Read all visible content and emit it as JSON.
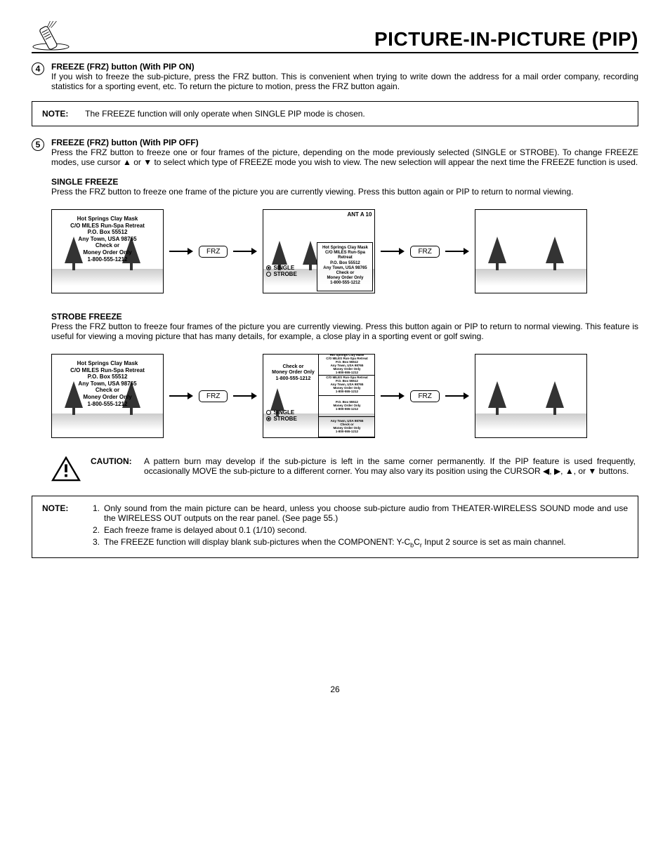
{
  "header": {
    "title": "PICTURE-IN-PICTURE (PIP)"
  },
  "step4": {
    "num": "4",
    "heading": "FREEZE (FRZ) button (With PIP ON)",
    "body": "If you wish to freeze the sub-picture, press the FRZ button.  This is convenient when trying to write down the address for a mail order company, recording statistics for a sporting event, etc.  To return the picture to motion, press the FRZ button again."
  },
  "note1": {
    "label": "NOTE:",
    "text": "The FREEZE function will only operate when SINGLE PIP mode is chosen."
  },
  "step5": {
    "num": "5",
    "heading": "FREEZE (FRZ) button (With PIP OFF)",
    "body": "Press the FRZ button to freeze one or four frames of the picture, depending on the mode previously selected (SINGLE or STROBE).  To change FREEZE modes, use cursor ▲ or ▼ to select which type of FREEZE mode you wish to view. The new selection will appear the next time the FREEZE function is used."
  },
  "single": {
    "heading": "SINGLE FREEZE",
    "body": "Press the FRZ button to freeze one frame of the picture you are currently viewing.  Press this button again or PIP to return to normal viewing."
  },
  "strobe": {
    "heading": "STROBE FREEZE",
    "body": "Press the FRZ button to freeze four frames of the picture you are currently viewing.  Press this button again or PIP to return to normal viewing.  This feature is useful for viewing a moving picture that has many details, for example, a close play in a sporting event or golf swing."
  },
  "ad": {
    "l1": "Hot Springs Clay Mask",
    "l2": "C/O MILES Run-Spa Retreat",
    "l3": "P.O. Box 55512",
    "l4": "Any Town, USA 98765",
    "l5": "Check or",
    "l6": "Money Order Only",
    "l7": "1-800-555-1212"
  },
  "labels": {
    "frz": "FRZ",
    "ant": "ANT A 10",
    "single": "SINGLE",
    "strobe": "STROBE"
  },
  "caution": {
    "label": "CAUTION:",
    "text": "A pattern burn may develop if the sub-picture is left in the same corner permanently.  If the PIP feature is used frequently, occasionally MOVE the sub-picture to a different corner.  You may also vary its position using the CURSOR ◀, ▶, ▲, or ▼ buttons."
  },
  "note2": {
    "label": "NOTE:",
    "n1": "Only sound from the main picture can be heard, unless you choose sub-picture audio from THEATER-WIRELESS SOUND mode and use the WIRELESS OUT outputs on the rear panel.  (See page 55.)",
    "n2": "Each freeze frame is delayed about 0.1 (1/10) second.",
    "n3a": "The FREEZE function will display blank sub-pictures when the COMPONENT: Y-C",
    "n3b": " Input 2 source is set as main channel."
  },
  "page": "26"
}
